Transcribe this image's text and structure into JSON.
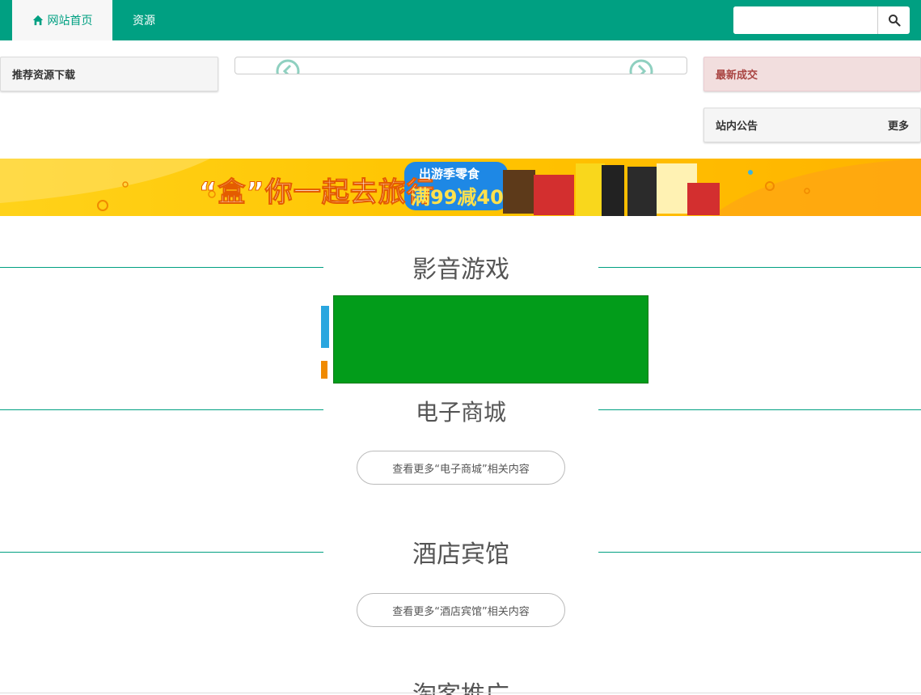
{
  "nav": {
    "home_label": "网站首页",
    "resource_label": "资源",
    "search_placeholder": ""
  },
  "panels": {
    "recommend_title": "推荐资源下载",
    "deals_title": "最新成交",
    "notice_title": "站内公告",
    "notice_more": "更多"
  },
  "banner": {
    "slogan": "“盒”你一起去旅行",
    "badge_line1": "出游季零食",
    "badge_line2": "满99减40"
  },
  "sections": [
    {
      "title": "影音游戏",
      "more": ""
    },
    {
      "title": "电子商城",
      "more": "查看更多“电子商城”相关内容"
    },
    {
      "title": "酒店宾馆",
      "more": "查看更多“酒店宾馆”相关内容"
    },
    {
      "title": "淘客推广",
      "more": ""
    }
  ],
  "colors": {
    "primary": "#00a082",
    "deal_bg": "#f2dede",
    "deal_text": "#a94442",
    "ad_green": "#029c1a"
  },
  "icons": {
    "home": "home-icon",
    "search": "search-icon",
    "prev": "chevron-left-icon",
    "next": "chevron-right-icon"
  }
}
